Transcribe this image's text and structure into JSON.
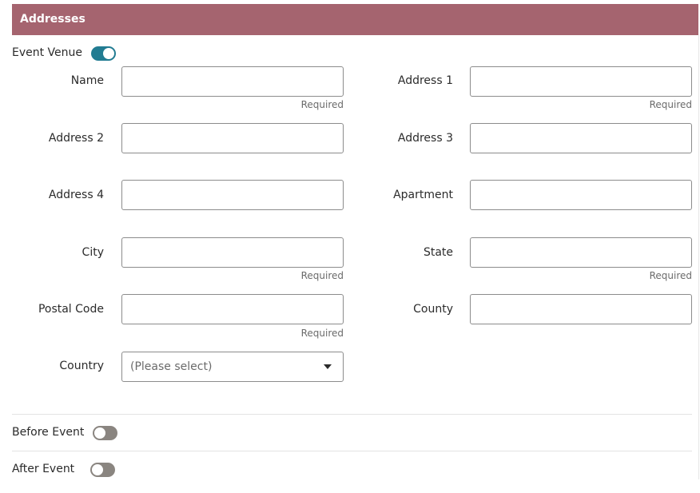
{
  "section": {
    "title": "Addresses"
  },
  "event_venue": {
    "label": "Event Venue",
    "enabled": true
  },
  "fields": {
    "name": {
      "label": "Name",
      "value": "",
      "hint": "Required"
    },
    "address1": {
      "label": "Address 1",
      "value": "",
      "hint": "Required"
    },
    "address2": {
      "label": "Address 2",
      "value": ""
    },
    "address3": {
      "label": "Address 3",
      "value": ""
    },
    "address4": {
      "label": "Address 4",
      "value": ""
    },
    "apartment": {
      "label": "Apartment",
      "value": ""
    },
    "city": {
      "label": "City",
      "value": "",
      "hint": "Required"
    },
    "state": {
      "label": "State",
      "value": "",
      "hint": "Required"
    },
    "postal_code": {
      "label": "Postal Code",
      "value": "",
      "hint": "Required"
    },
    "county": {
      "label": "County",
      "value": ""
    },
    "country": {
      "label": "Country",
      "selected": "(Please select)"
    }
  },
  "before_event": {
    "label": "Before Event",
    "enabled": false
  },
  "after_event": {
    "label": "After Event",
    "enabled": false
  },
  "colors": {
    "header_bg": "#a5646f",
    "toggle_on": "#227c92",
    "toggle_off": "#8a8580"
  },
  "icons": {
    "country_dropdown": "caret-down-icon"
  }
}
